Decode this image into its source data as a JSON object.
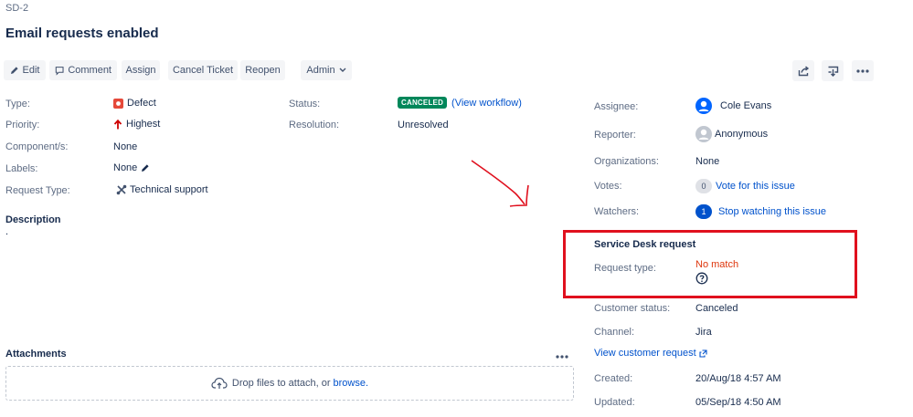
{
  "header": {
    "issue_key": "SD-2",
    "summary": "Email requests enabled"
  },
  "toolbar": {
    "edit": "Edit",
    "comment": "Comment",
    "assign": "Assign",
    "cancel_ticket": "Cancel Ticket",
    "reopen": "Reopen",
    "admin": "Admin"
  },
  "details": {
    "type_label": "Type:",
    "type_value": "Defect",
    "priority_label": "Priority:",
    "priority_value": "Highest",
    "components_label": "Component/s:",
    "components_value": "None",
    "labels_label": "Labels:",
    "labels_value": "None",
    "request_type_label": "Request Type:",
    "request_type_value": "Technical support",
    "status_label": "Status:",
    "status_value": "CANCELED",
    "view_workflow": "(View workflow)",
    "resolution_label": "Resolution:",
    "resolution_value": "Unresolved"
  },
  "description": {
    "title": "Description",
    "text": "."
  },
  "attachments": {
    "title": "Attachments",
    "drop_text": "Drop files to attach, or",
    "browse": "browse."
  },
  "people": {
    "assignee_label": "Assignee:",
    "assignee_value": "Cole Evans",
    "reporter_label": "Reporter:",
    "reporter_value": "Anonymous",
    "organizations_label": "Organizations:",
    "organizations_value": "None",
    "votes_label": "Votes:",
    "votes_count": "0",
    "vote_link": "Vote for this issue",
    "watchers_label": "Watchers:",
    "watchers_count": "1",
    "watch_link": "Stop watching this issue"
  },
  "service_desk": {
    "title": "Service Desk request",
    "request_type_label": "Request type:",
    "request_type_value": "No match",
    "customer_status_label": "Customer status:",
    "customer_status_value": "Canceled",
    "channel_label": "Channel:",
    "channel_value": "Jira",
    "view_customer_request": "View customer request"
  },
  "dates": {
    "created_label": "Created:",
    "created_value": "20/Aug/18 4:57 AM",
    "updated_label": "Updated:",
    "updated_value": "05/Sep/18 4:50 AM"
  },
  "colors": {
    "canceled_lozenge": "#00875a",
    "annotation_red": "#e0101e",
    "link_blue": "#0052cc",
    "no_match_red": "#de350b"
  },
  "icons": [
    "edit-icon",
    "comment-icon",
    "chevron-down-icon",
    "share-icon",
    "export-icon",
    "more-icon",
    "defect-icon",
    "priority-highest-icon",
    "pencil-icon",
    "technical-support-icon",
    "user-avatar-icon",
    "anonymous-avatar-icon",
    "help-icon",
    "upload-cloud-icon",
    "external-link-icon"
  ]
}
